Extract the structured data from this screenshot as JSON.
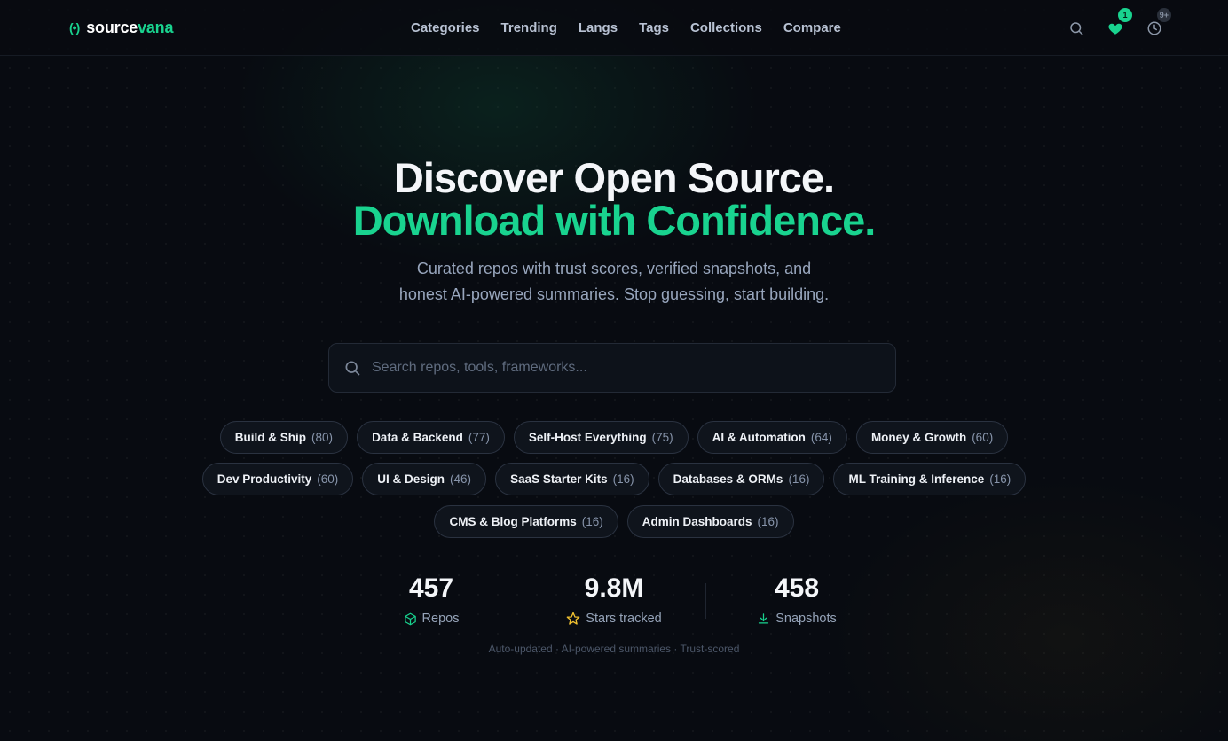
{
  "brand": {
    "mark": "(•)",
    "name_part1": "source",
    "name_part2": "vana",
    "accent_color": "#19d38f"
  },
  "nav": {
    "items": [
      "Categories",
      "Trending",
      "Langs",
      "Tags",
      "Collections",
      "Compare"
    ]
  },
  "header_icons": {
    "search": "search-icon",
    "favorites": {
      "icon": "heart-icon",
      "badge": "1"
    },
    "history": {
      "icon": "clock-icon",
      "badge": "9+"
    }
  },
  "hero": {
    "title_line1": "Discover Open Source.",
    "title_line2": "Download with Confidence.",
    "subtitle_line1": "Curated repos with trust scores, verified snapshots, and",
    "subtitle_line2": "honest AI-powered summaries. Stop guessing, start building."
  },
  "search": {
    "placeholder": "Search repos, tools, frameworks...",
    "value": ""
  },
  "categories": {
    "row1": [
      {
        "label": "Build & Ship",
        "count": "(80)"
      },
      {
        "label": "Data & Backend",
        "count": "(77)"
      },
      {
        "label": "Self-Host Everything",
        "count": "(75)"
      },
      {
        "label": "AI & Automation",
        "count": "(64)"
      },
      {
        "label": "Money & Growth",
        "count": "(60)"
      }
    ],
    "row2": [
      {
        "label": "Dev Productivity",
        "count": "(60)"
      },
      {
        "label": "UI & Design",
        "count": "(46)"
      },
      {
        "label": "SaaS Starter Kits",
        "count": "(16)"
      },
      {
        "label": "Databases & ORMs",
        "count": "(16)"
      },
      {
        "label": "ML Training & Inference",
        "count": "(16)"
      }
    ],
    "row3": [
      {
        "label": "CMS & Blog Platforms",
        "count": "(16)"
      },
      {
        "label": "Admin Dashboards",
        "count": "(16)"
      }
    ]
  },
  "stats": [
    {
      "value": "457",
      "label": "Repos",
      "icon": "box-icon"
    },
    {
      "value": "9.8M",
      "label": "Stars tracked",
      "icon": "star-icon"
    },
    {
      "value": "458",
      "label": "Snapshots",
      "icon": "download-icon"
    }
  ],
  "footer_note": "Auto-updated · AI-powered summaries · Trust-scored"
}
